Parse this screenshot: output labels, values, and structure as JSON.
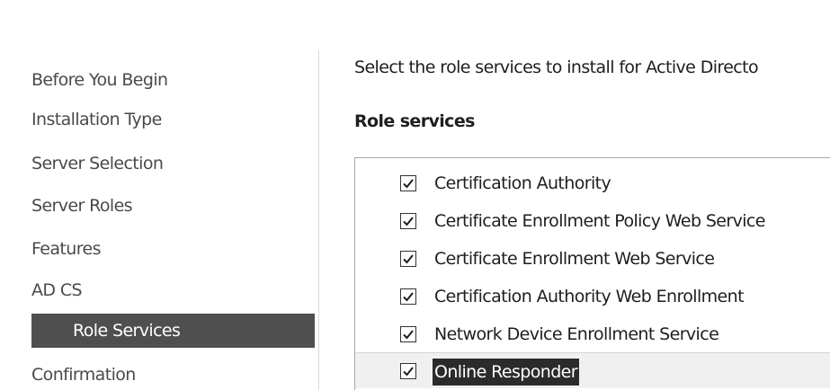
{
  "nav": {
    "items": [
      {
        "label": "Before You Begin",
        "selected": false
      },
      {
        "label": "Installation Type",
        "selected": false
      },
      {
        "label": "Server Selection",
        "selected": false
      },
      {
        "label": "Server Roles",
        "selected": false
      },
      {
        "label": "Features",
        "selected": false
      },
      {
        "label": "AD CS",
        "selected": false
      },
      {
        "label": "Role Services",
        "selected": true
      },
      {
        "label": "Confirmation",
        "selected": false
      }
    ]
  },
  "main": {
    "intro": "Select the role services to install for Active Directo",
    "section_title": "Role services",
    "role_services": [
      {
        "label": "Certification Authority",
        "checked": true
      },
      {
        "label": "Certificate Enrollment Policy Web Service",
        "checked": true
      },
      {
        "label": "Certificate Enrollment Web Service",
        "checked": true
      },
      {
        "label": "Certification Authority Web Enrollment",
        "checked": true
      },
      {
        "label": "Network Device Enrollment Service",
        "checked": true
      },
      {
        "label": "Online Responder",
        "checked": true
      }
    ]
  },
  "colors": {
    "selected_nav_bg": "#4f4f4f",
    "selected_nav_text": "#ffffff",
    "focus_highlight": "#2b2b2b"
  }
}
